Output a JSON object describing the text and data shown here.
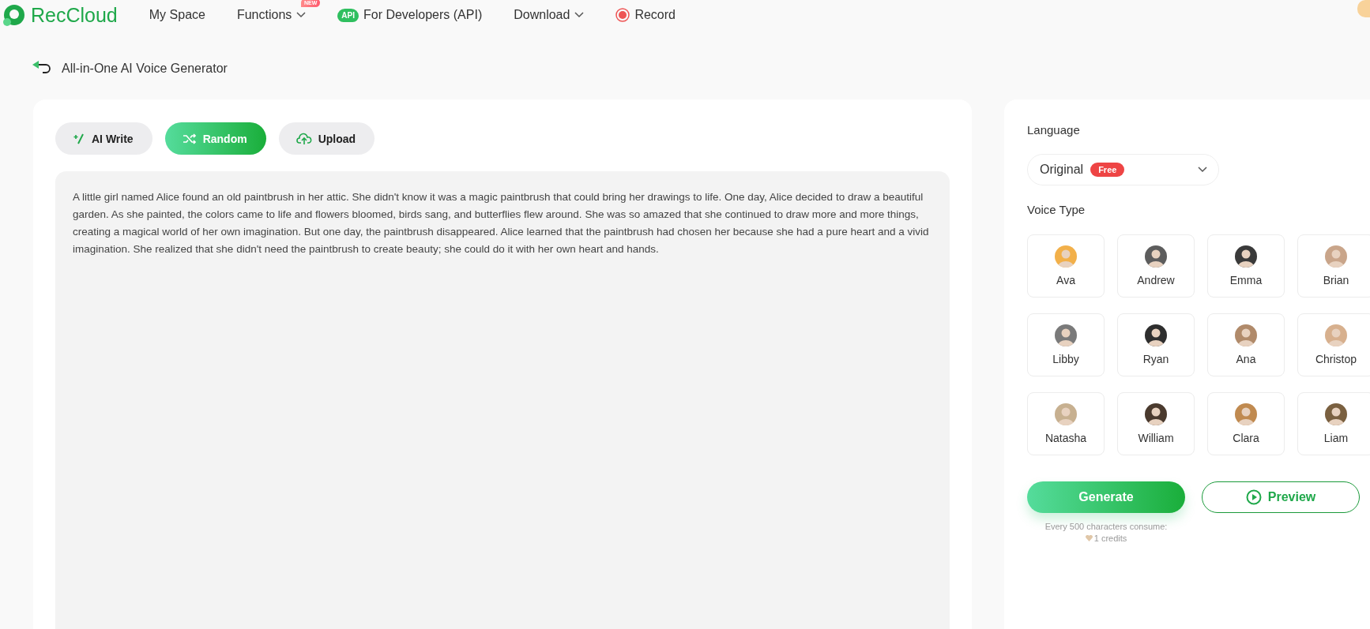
{
  "nav": {
    "logo": "RecCloud",
    "items": [
      {
        "label": "My Space",
        "kind": "plain"
      },
      {
        "label": "Functions",
        "kind": "dropdown",
        "badge": "NEW"
      },
      {
        "label": "For Developers (API)",
        "kind": "api",
        "badge": "API"
      },
      {
        "label": "Download",
        "kind": "dropdown"
      },
      {
        "label": "Record",
        "kind": "record"
      }
    ]
  },
  "header": {
    "title": "All-in-One AI Voice Generator"
  },
  "editor": {
    "tools": [
      {
        "label": "AI Write",
        "kind": "write",
        "selected": false
      },
      {
        "label": "Random",
        "kind": "shuffle",
        "selected": true
      },
      {
        "label": "Upload",
        "kind": "upload",
        "selected": false
      }
    ],
    "text": "A little girl named Alice found an old paintbrush in her attic. She didn't know it was a magic paintbrush that could bring her drawings to life.  One day, Alice decided to draw a beautiful garden. As she painted, the colors came to life and flowers bloomed, birds sang, and butterflies flew around. She was so amazed that she continued to draw more and more things, creating a magical world of her own imagination.  But one day, the paintbrush disappeared. Alice learned that the paintbrush had chosen her because she had a pure heart and a vivid imagination. She realized that she didn't need the paintbrush to create beauty; she could do it with her own heart and hands."
  },
  "settings": {
    "language_label": "Language",
    "language": {
      "value": "Original",
      "badge": "Free"
    },
    "voice_type_label": "Voice Type",
    "voices": [
      {
        "name": "Ava",
        "selected": false
      },
      {
        "name": "Andrew",
        "selected": false
      },
      {
        "name": "Emma",
        "selected": false
      },
      {
        "name": "Brian",
        "selected": false
      },
      {
        "name": "Libby",
        "selected": false
      },
      {
        "name": "Ryan",
        "selected": false
      },
      {
        "name": "Ana",
        "selected": false
      },
      {
        "name": "Christop",
        "selected": false
      },
      {
        "name": "Natasha",
        "selected": false
      },
      {
        "name": "William",
        "selected": false
      },
      {
        "name": "Clara",
        "selected": false
      },
      {
        "name": "Liam",
        "selected": false
      }
    ],
    "generate": "Generate",
    "preview": "Preview",
    "note": "Every 500 characters consume:",
    "credits": "1 credits"
  }
}
